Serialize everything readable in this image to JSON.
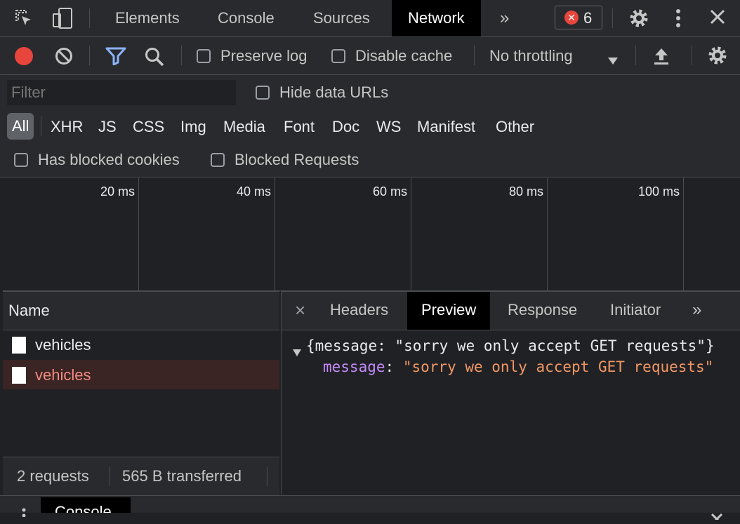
{
  "top_tabs": [
    "Elements",
    "Console",
    "Sources",
    "Network"
  ],
  "active_top_tab": "Network",
  "error_count": "6",
  "toolbar": {
    "preserve_log": "Preserve log",
    "disable_cache": "Disable cache",
    "throttling": "No throttling"
  },
  "filter": {
    "placeholder": "Filter",
    "hide_data_urls": "Hide data URLs",
    "types": [
      "All",
      "XHR",
      "JS",
      "CSS",
      "Img",
      "Media",
      "Font",
      "Doc",
      "WS",
      "Manifest",
      "Other"
    ],
    "has_blocked_cookies": "Has blocked cookies",
    "blocked_requests": "Blocked Requests"
  },
  "timeline": {
    "labels": [
      "20 ms",
      "40 ms",
      "60 ms",
      "80 ms",
      "100 ms"
    ]
  },
  "requests": {
    "header": "Name",
    "rows": [
      {
        "name": "vehicles",
        "color": "#e8eaed"
      },
      {
        "name": "vehicles",
        "color": "#f28b82"
      }
    ],
    "count": "2 requests",
    "transferred": "565 B transferred"
  },
  "detail": {
    "close": "×",
    "tabs": [
      "Headers",
      "Preview",
      "Response",
      "Initiator"
    ],
    "active_tab": "Preview",
    "preview_summary": "{message: \"sorry we only accept GET requests\"}",
    "preview_key": "message",
    "preview_value": "\"sorry we only accept GET requests\""
  },
  "drawer": {
    "tab": "Console"
  },
  "colors": {
    "record": "#e8453c",
    "filter_active": "#8ab4f8",
    "error_badge": "#e8453c",
    "json_key": "#c58af9",
    "json_string": "#f29766",
    "error_row_bg": "#3b2424"
  }
}
